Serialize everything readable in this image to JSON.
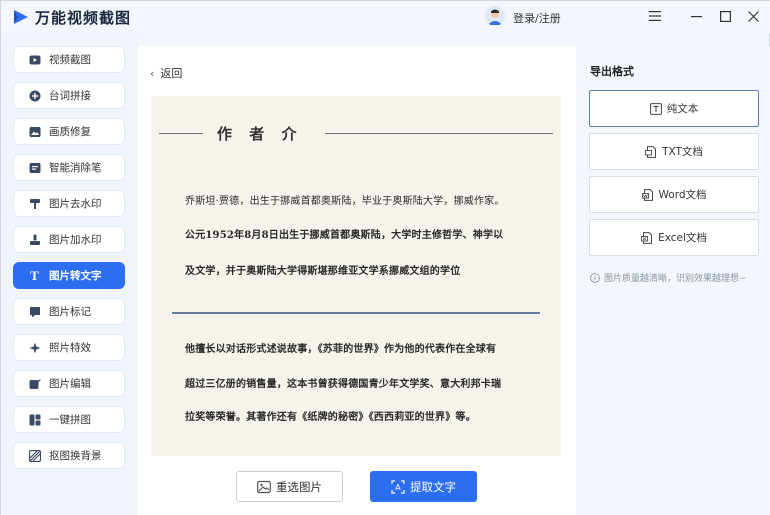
{
  "app": {
    "title": "万能视频截图"
  },
  "titlebar": {
    "login_label": "登录/注册"
  },
  "sidebar": {
    "items": [
      {
        "label": "视频截图",
        "icon": "video-screenshot-icon"
      },
      {
        "label": "台词拼接",
        "icon": "subtitle-stitch-icon"
      },
      {
        "label": "画质修复",
        "icon": "quality-repair-icon"
      },
      {
        "label": "智能消除笔",
        "icon": "eraser-pen-icon"
      },
      {
        "label": "图片去水印",
        "icon": "remove-watermark-icon"
      },
      {
        "label": "图片加水印",
        "icon": "add-watermark-icon"
      },
      {
        "label": "图片转文字",
        "icon": "text-t-icon"
      },
      {
        "label": "图片标记",
        "icon": "image-mark-icon"
      },
      {
        "label": "照片特效",
        "icon": "photo-effects-icon"
      },
      {
        "label": "图片编辑",
        "icon": "image-edit-icon"
      },
      {
        "label": "一键拼图",
        "icon": "collage-icon"
      },
      {
        "label": "抠图换背景",
        "icon": "cutout-background-icon"
      }
    ],
    "active_index": 6,
    "accent_color": "#2c6df2"
  },
  "main": {
    "back_label": "返回",
    "preview": {
      "title": "作 者 介",
      "paragraph1": [
        "乔斯坦·贾德，出生于挪威首都奥斯陆，毕业于奥斯陆大学，挪威作家。",
        "公元1952年8月8日出生于挪威首都奥斯陆，大学时主修哲学、神学以",
        "及文学，并于奥斯陆大学得斯堪那维亚文学系挪威文组的学位"
      ],
      "paragraph2": [
        "他擅长以对话形式述说故事，《苏菲的世界》作为他的代表作在全球有",
        "超过三亿册的销售量，这本书曾获得德国青少年文学奖、意大利邦卡瑞",
        "拉奖等荣誉。其著作还有《纸牌的秘密》《西西莉亚的世界》等。"
      ]
    },
    "reselect_label": "重选图片",
    "extract_label": "提取文字"
  },
  "export": {
    "title": "导出格式",
    "formats": [
      {
        "label": "纯文本",
        "icon": "plain-text-icon"
      },
      {
        "label": "TXT文档",
        "icon": "txt-doc-icon"
      },
      {
        "label": "Word文档",
        "icon": "word-doc-icon"
      },
      {
        "label": "Excel文档",
        "icon": "excel-doc-icon"
      }
    ],
    "selected_index": 0,
    "hint": "图片质量越清晰，识别效果越理想~"
  }
}
